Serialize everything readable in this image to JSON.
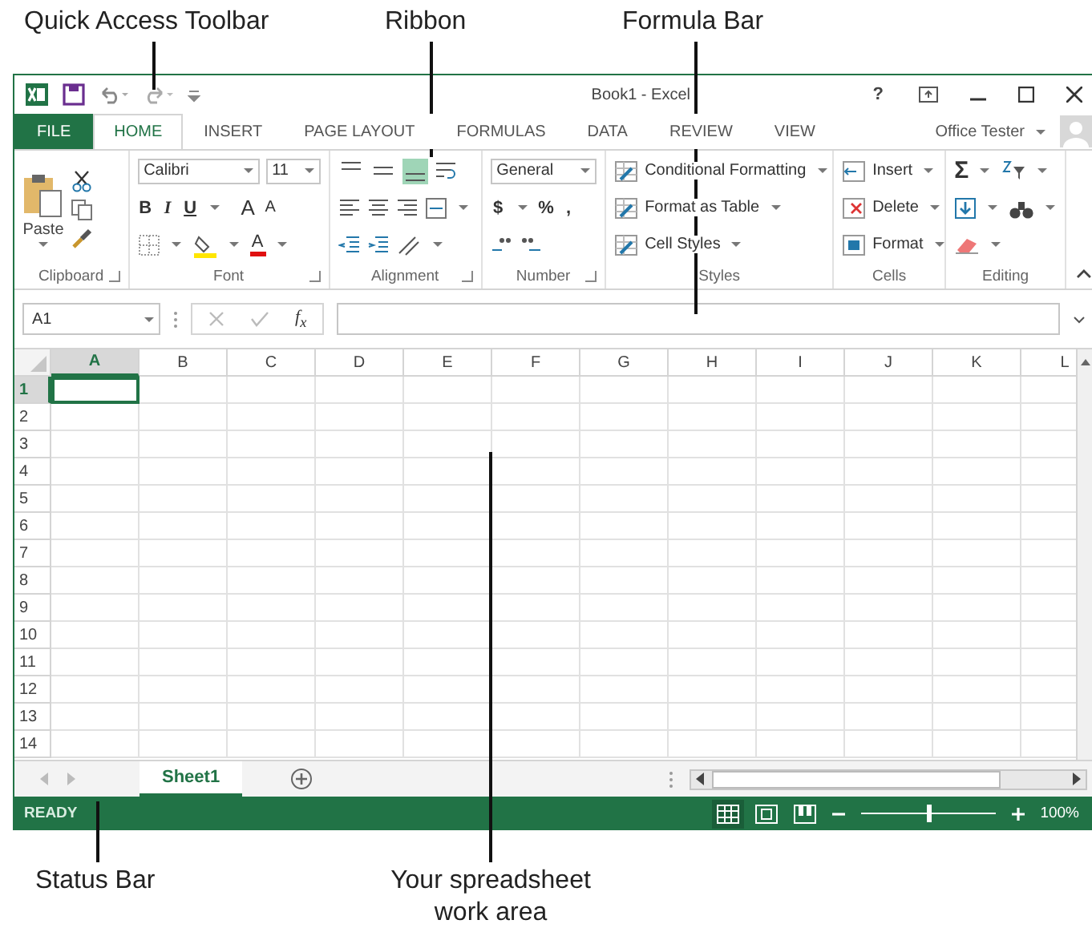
{
  "callouts": [
    {
      "text": "Quick Access Toolbar"
    },
    {
      "text": "Ribbon"
    },
    {
      "text": "Formula Bar"
    },
    {
      "text": "Status Bar"
    },
    {
      "text": "Your spreadsheet work area"
    }
  ],
  "window": {
    "title": "Book1 - Excel",
    "help": "?",
    "user": "Office Tester"
  },
  "tabs": [
    {
      "label": "FILE",
      "kind": "backstage",
      "selected": false
    },
    {
      "label": "HOME",
      "kind": "tab",
      "selected": true
    },
    {
      "label": "INSERT",
      "kind": "tab",
      "selected": false
    },
    {
      "label": "PAGE LAYOUT",
      "kind": "tab",
      "selected": false
    },
    {
      "label": "FORMULAS",
      "kind": "tab",
      "selected": false
    },
    {
      "label": "DATA",
      "kind": "tab",
      "selected": false
    },
    {
      "label": "REVIEW",
      "kind": "tab",
      "selected": false
    },
    {
      "label": "VIEW",
      "kind": "tab",
      "selected": false
    }
  ],
  "ribbon": {
    "clipboard": {
      "label": "Clipboard",
      "paste": "Paste"
    },
    "font": {
      "label": "Font",
      "name": "Calibri",
      "size": "11",
      "bold": "B",
      "italic": "I",
      "underline": "U",
      "grow": "A",
      "shrink": "A",
      "color_letter": "A"
    },
    "alignment": {
      "label": "Alignment",
      "vertical": [
        {
          "kind": "top",
          "selected": false
        },
        {
          "kind": "middle",
          "selected": false
        },
        {
          "kind": "bottom",
          "selected": true
        }
      ]
    },
    "number": {
      "label": "Number",
      "format": "General",
      "currency": "$",
      "percent": "%",
      "comma": ","
    },
    "styles": {
      "label": "Styles",
      "items": [
        "Conditional Formatting",
        "Format as Table",
        "Cell Styles"
      ]
    },
    "cells": {
      "label": "Cells",
      "items": [
        {
          "kind": "insert",
          "label": "Insert"
        },
        {
          "kind": "delete",
          "label": "Delete"
        },
        {
          "kind": "format",
          "label": "Format"
        }
      ]
    },
    "editing": {
      "label": "Editing",
      "sum": "Σ"
    }
  },
  "formula_bar": {
    "name_box": "A1",
    "function_label": "f$_{x}$"
  },
  "columns": [
    {
      "label": "A",
      "selected": true
    },
    {
      "label": "B",
      "selected": false
    },
    {
      "label": "C",
      "selected": false
    },
    {
      "label": "D",
      "selected": false
    },
    {
      "label": "E",
      "selected": false
    },
    {
      "label": "F",
      "selected": false
    },
    {
      "label": "G",
      "selected": false
    },
    {
      "label": "H",
      "selected": false
    },
    {
      "label": "I",
      "selected": false
    },
    {
      "label": "J",
      "selected": false
    },
    {
      "label": "K",
      "selected": false
    },
    {
      "label": "L",
      "selected": false
    }
  ],
  "rows": [
    {
      "label": "1",
      "selected": true
    },
    {
      "label": "2",
      "selected": false
    },
    {
      "label": "3",
      "selected": false
    },
    {
      "label": "4",
      "selected": false
    },
    {
      "label": "5",
      "selected": false
    },
    {
      "label": "6",
      "selected": false
    },
    {
      "label": "7",
      "selected": false
    },
    {
      "label": "8",
      "selected": false
    },
    {
      "label": "9",
      "selected": false
    },
    {
      "label": "10",
      "selected": false
    },
    {
      "label": "11",
      "selected": false
    },
    {
      "label": "12",
      "selected": false
    },
    {
      "label": "13",
      "selected": false
    },
    {
      "label": "14",
      "selected": false
    }
  ],
  "sheets": [
    {
      "label": "Sheet1",
      "selected": true
    }
  ],
  "status_bar": {
    "status": "READY",
    "zoom": "100%",
    "zoom_slider": {
      "level": 0.5
    }
  }
}
